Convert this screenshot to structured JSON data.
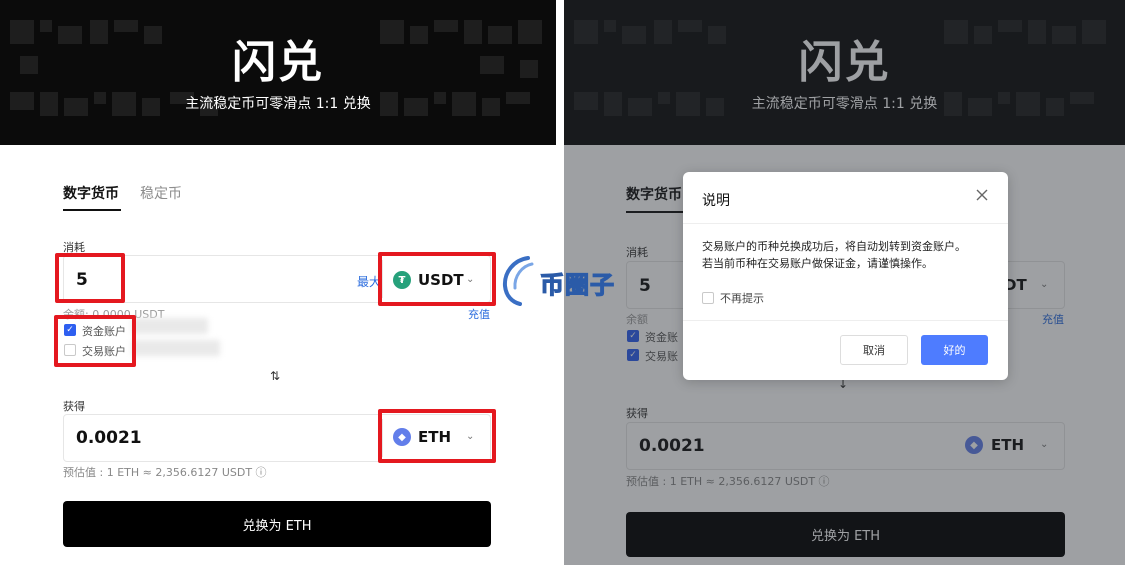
{
  "colors": {
    "banner_bg": "#0b0b0b",
    "primary_button": "#000000",
    "link_blue": "#2b6cde",
    "highlight_red": "#e4181f",
    "usdt_green": "#26a17b",
    "eth_blue": "#627eea",
    "dialog_ok_blue": "#4e7cff",
    "checkbox_blue": "#2e5ff0"
  },
  "left": {
    "banner": {
      "title": "闪兑",
      "subtitle": "主流稳定币可零滑点 1:1 兑换"
    },
    "tabs": [
      {
        "label": "数字货币"
      },
      {
        "label": "稳定币"
      }
    ],
    "from": {
      "label": "消耗",
      "amount": "5",
      "max_label": "最大",
      "coin_icon": "usdt-icon",
      "coin": "USDT",
      "balance": "余额: 0.0000 USDT",
      "deposit_label": "充值"
    },
    "accounts": [
      {
        "label": "资金账户",
        "checked": true
      },
      {
        "label": "交易账户",
        "checked": false
      }
    ],
    "swap_icon": "swap-arrows-icon",
    "to": {
      "label": "获得",
      "amount": "0.0021",
      "coin_icon": "eth-icon",
      "coin": "ETH",
      "rate": "预估值 : 1 ETH ≈ 2,356.6127 USDT ⓘ"
    },
    "convert_label": "兑换为 ETH"
  },
  "right": {
    "banner": {
      "title": "闪兑",
      "subtitle": "主流稳定币可零滑点 1:1 兑换"
    },
    "tabs": [
      {
        "label": "数字货币"
      }
    ],
    "from": {
      "label": "消耗",
      "amount": "5",
      "coin_partial": "DT",
      "balance": "余额",
      "deposit_label": "充值"
    },
    "accounts": [
      {
        "label": "资金账",
        "checked": true
      },
      {
        "label": "交易账",
        "checked": true
      }
    ],
    "to": {
      "label": "获得",
      "amount": "0.0021",
      "coin": "ETH",
      "rate": "预估值 : 1 ETH ≈ 2,356.6127 USDT ⓘ"
    },
    "convert_label": "兑换为 ETH",
    "dialog": {
      "title": "说明",
      "body_line1": "交易账户的币种兑换成功后，将自动划转到资金账户。",
      "body_line2": "若当前币种在交易账户做保证金，请谨慎操作。",
      "dont_show_label": "不再提示",
      "cancel_label": "取消",
      "ok_label": "好的"
    }
  },
  "watermark": {
    "text": "币圈子"
  }
}
